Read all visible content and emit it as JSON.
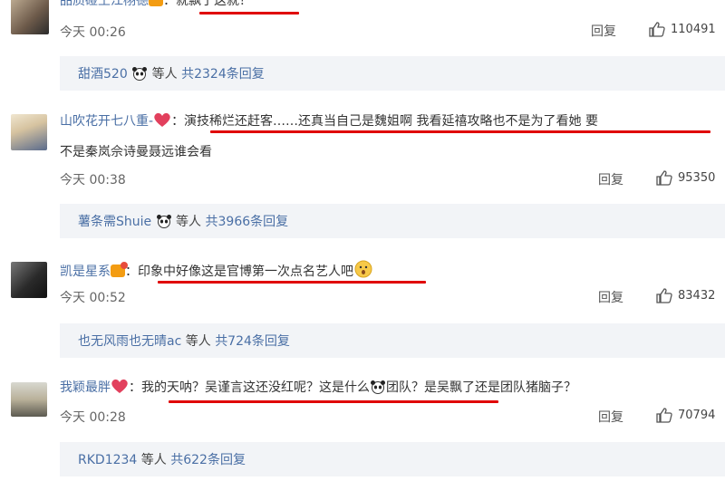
{
  "comments": [
    {
      "username": "品质碰王江栩德",
      "text": "：就飘了这就？",
      "time": "今天 00:26",
      "reply_label": "回复",
      "likes": "110491",
      "reply_summary": {
        "names": "甜酒520",
        "others": "等人",
        "count": "共2324条回复"
      }
    },
    {
      "username": "山吹花开七八重-",
      "text_line1": "：演技稀烂还赶客……还真当自己是魏姐啊 我看延禧攻略也不是为了看她 要",
      "text_line2": "不是秦岚佘诗曼聂远谁会看",
      "time": "今天 00:38",
      "reply_label": "回复",
      "likes": "95350",
      "reply_summary": {
        "names": "薯条需Shuie",
        "others": "等人",
        "count": "共3966条回复"
      }
    },
    {
      "username": "凯是星系",
      "text": "：印象中好像这是官博第一次点名艺人吧",
      "time": "今天 00:52",
      "reply_label": "回复",
      "likes": "83432",
      "reply_summary": {
        "names": "也无风雨也无晴ac",
        "others": "等人",
        "count": "共724条回复"
      }
    },
    {
      "username": "我颖最胖",
      "text_part1": "：我的天呐？吴谨言这还没红呢？这是什么",
      "text_part2": "团队？是吴飘了还是团队猪脑子？",
      "time": "今天 00:28",
      "reply_label": "回复",
      "likes": "70794",
      "reply_summary": {
        "names": "RKD1234",
        "others": "等人",
        "count": "共622条回复"
      }
    }
  ],
  "colors": {
    "username": "#4a6fa5",
    "underline": "#e00000",
    "reply_bg": "#f2f4f7"
  }
}
